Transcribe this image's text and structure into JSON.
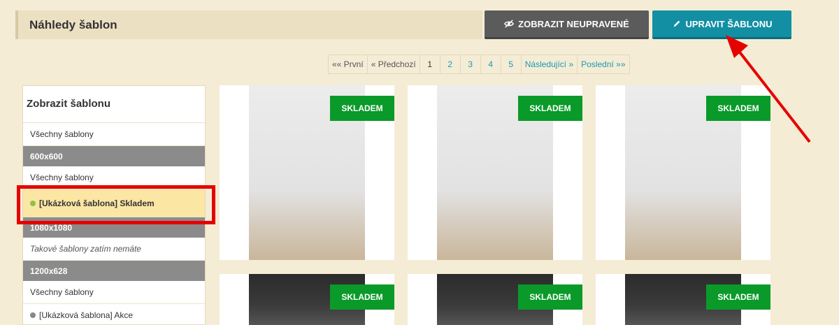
{
  "header": {
    "title": "Náhledy šablon"
  },
  "buttons": {
    "show_unedited": "ZOBRAZIT NEUPRAVENÉ",
    "edit_template": "UPRAVIT ŠABLONU"
  },
  "pagination": {
    "first": "«« První",
    "prev": "« Předchozí",
    "pages": [
      "1",
      "2",
      "3",
      "4",
      "5"
    ],
    "next": "Následující »",
    "last": "Poslední »»",
    "current": "1"
  },
  "sidebar": {
    "title": "Zobrazit šablonu",
    "items": [
      {
        "type": "row",
        "label": "Všechny šablony"
      },
      {
        "type": "section",
        "label": "600x600"
      },
      {
        "type": "row",
        "label": "Všechny šablony"
      },
      {
        "type": "active",
        "label": "[Ukázková šablona] Skladem"
      },
      {
        "type": "section",
        "label": "1080x1080"
      },
      {
        "type": "italic",
        "label": "Takové šablony zatím nemáte"
      },
      {
        "type": "section",
        "label": "1200x628"
      },
      {
        "type": "row",
        "label": "Všechny šablony"
      },
      {
        "type": "row-dot",
        "label": "[Ukázková šablona] Akce"
      }
    ]
  },
  "previews": {
    "badge": "SKLADEM"
  },
  "colors": {
    "accent": "#128fa3",
    "badge": "#0a9a2a",
    "highlight": "#e60000"
  }
}
